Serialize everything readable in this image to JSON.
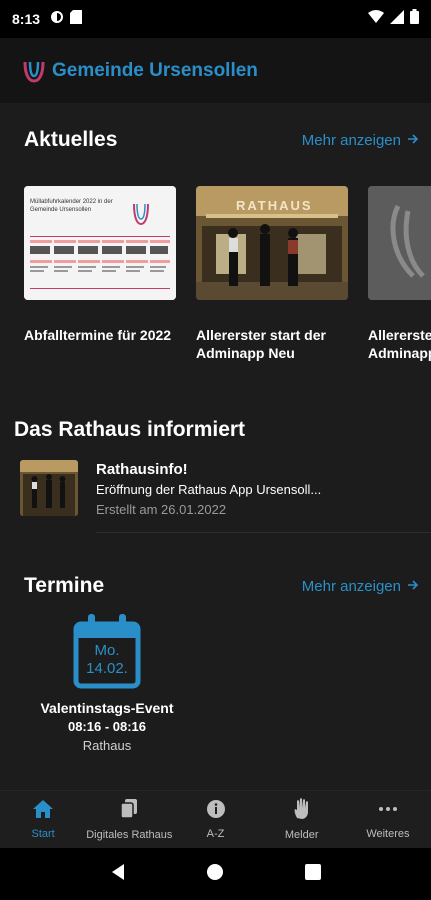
{
  "status": {
    "time": "8:13"
  },
  "appbar": {
    "title": "Gemeinde Ursensollen"
  },
  "aktuelles": {
    "title": "Aktuelles",
    "more": "Mehr anzeigen",
    "cards": [
      {
        "title": "Abfalltermine für 2022",
        "thumb_text": "Müllabfuhrkalender 2022 in der Gemeinde Ursensollen"
      },
      {
        "title": "Allererster start der Adminapp Neu",
        "thumb_text": "RATHAUS"
      },
      {
        "title": "Allererster Adminapp"
      }
    ]
  },
  "rathaus": {
    "title": "Das Rathaus informiert",
    "item": {
      "title": "Rathausinfo!",
      "subtitle": "Eröffnung der Rathaus App Ursensoll...",
      "meta": "Erstellt am 26.01.2022"
    }
  },
  "termine": {
    "title": "Termine",
    "more": "Mehr anzeigen",
    "event": {
      "day": "Mo.",
      "date": "14.02.",
      "name": "Valentinstags-Event",
      "time": "08:16 - 08:16",
      "place": "Rathaus"
    }
  },
  "nav": {
    "items": [
      {
        "label": "Start",
        "icon": "home-icon",
        "active": true
      },
      {
        "label": "Digitales Rathaus",
        "icon": "documents-icon",
        "active": false
      },
      {
        "label": "A-Z",
        "icon": "info-icon",
        "active": false
      },
      {
        "label": "Melder",
        "icon": "hand-icon",
        "active": false
      },
      {
        "label": "Weiteres",
        "icon": "more-icon",
        "active": false
      }
    ]
  },
  "colors": {
    "accent": "#2a8fc8",
    "background": "#1c1c1c"
  }
}
